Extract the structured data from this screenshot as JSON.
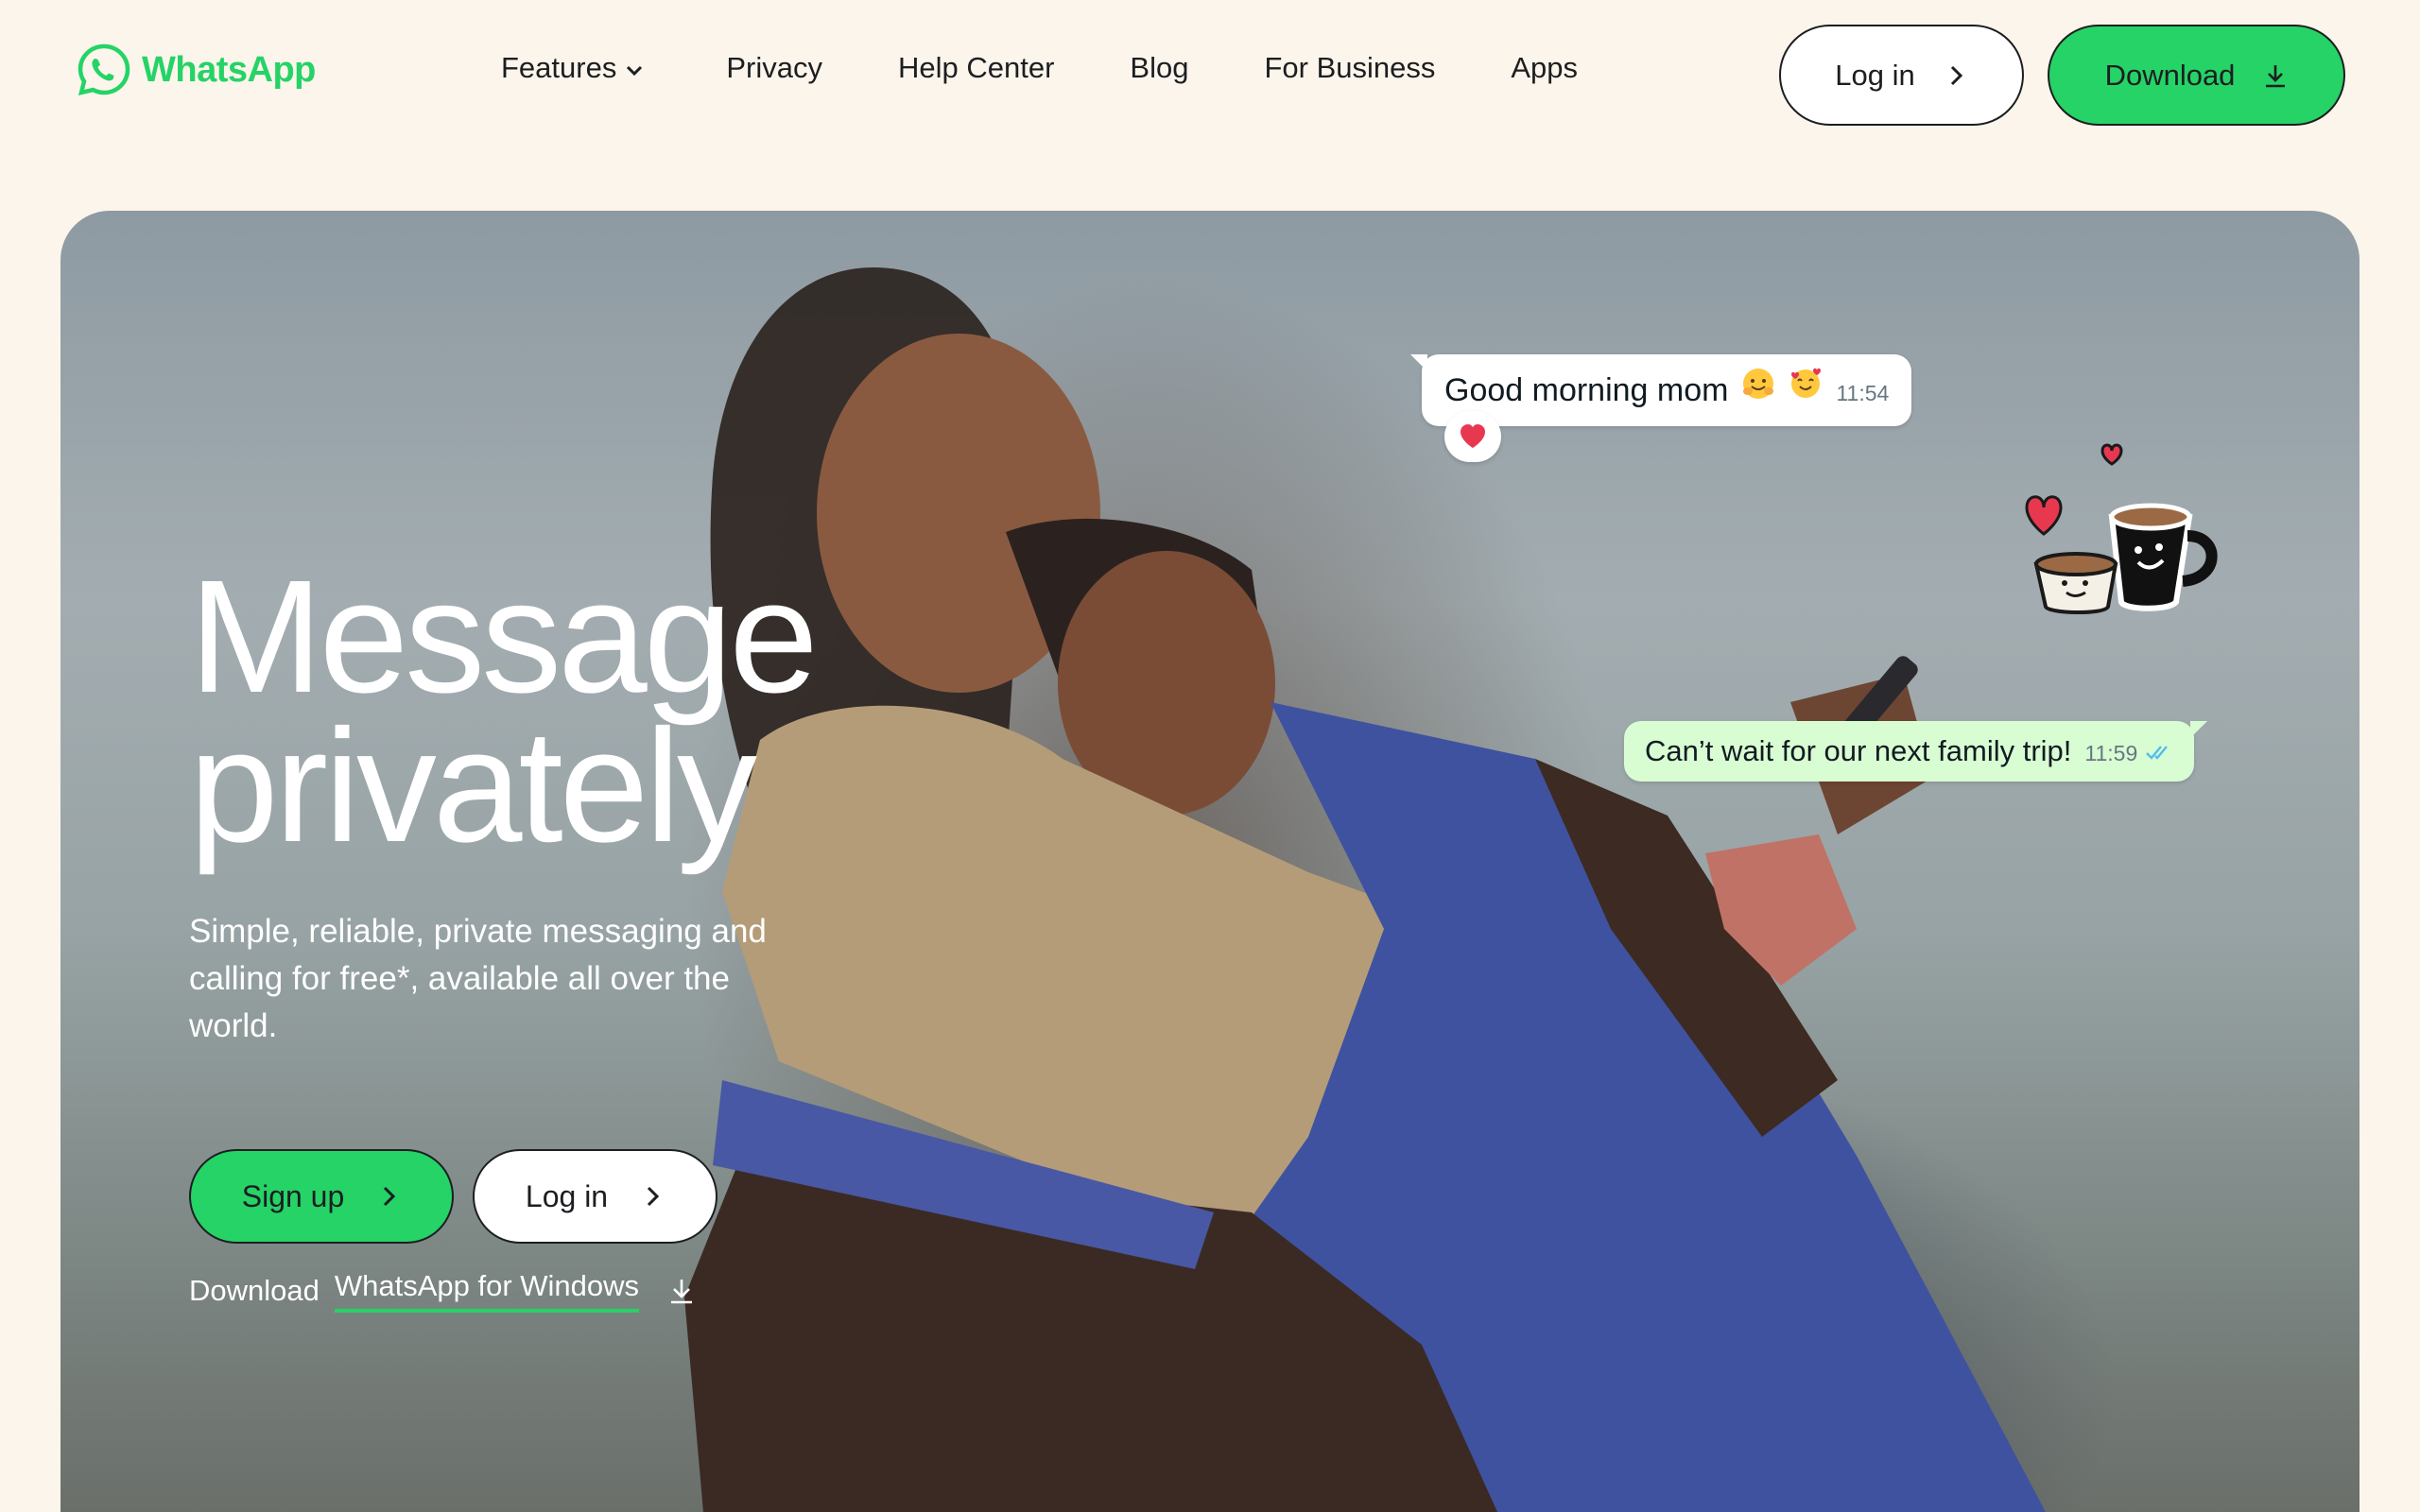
{
  "brand": {
    "name": "WhatsApp",
    "color": "#25D366"
  },
  "nav": {
    "items": [
      {
        "label": "Features",
        "has_dropdown": true
      },
      {
        "label": "Privacy"
      },
      {
        "label": "Help Center"
      },
      {
        "label": "Blog"
      },
      {
        "label": "For Business"
      },
      {
        "label": "Apps"
      }
    ],
    "login_label": "Log in",
    "download_label": "Download"
  },
  "hero": {
    "title_line1": "Message",
    "title_line2": "privately",
    "subtitle": "Simple, reliable, private messaging and calling for free*, available all over the world.",
    "signup_label": "Sign up",
    "login_label": "Log in",
    "download_prefix": "Download",
    "download_link": "WhatsApp for Windows"
  },
  "chat": {
    "incoming": {
      "text": "Good morning mom",
      "emojis": [
        "hugging-face",
        "smiling-face-with-hearts"
      ],
      "time": "11:54",
      "reaction": "red-heart"
    },
    "outgoing": {
      "text": "Can’t wait for our next family trip!",
      "time": "11:59",
      "status": "read"
    }
  },
  "sticker": {
    "name": "coffee-cups-hearts-sticker"
  },
  "colors": {
    "background": "#FCF5EB",
    "accent": "#25D366",
    "outgoing_bubble": "#D9FDD3",
    "read_ticks": "#53BDEB"
  }
}
